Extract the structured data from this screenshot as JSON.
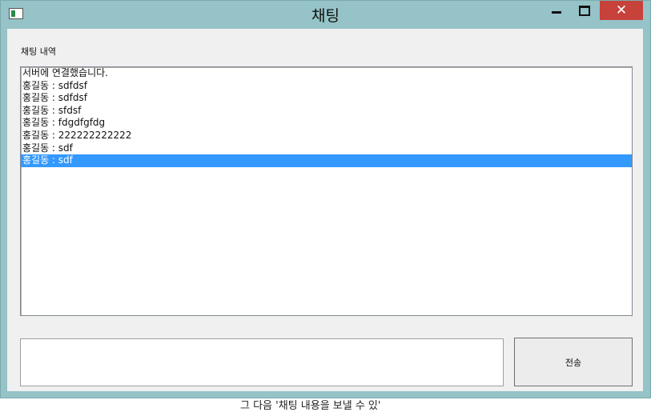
{
  "window": {
    "title": "채팅",
    "close_glyph": "✕"
  },
  "chat": {
    "history_label": "채팅 내역",
    "messages": [
      "서버에 연결했습니다.",
      "홍길동 : sdfdsf",
      "홍길동 : sdfdsf",
      "홍길동 : sfdsf",
      "홍길동 : fdgdfgfdg",
      "홍길동 : 222222222222",
      "홍길동 : sdf",
      "홍길동 : sdf"
    ],
    "selected_index": 7
  },
  "composer": {
    "input_value": "",
    "send_label": "전송"
  },
  "background": {
    "partial_text": "그 다음 '채팅 내용을 보낼 수 있'"
  },
  "colors": {
    "frame": "#95c3c7",
    "close": "#c7423b",
    "selection": "#3399ff"
  }
}
